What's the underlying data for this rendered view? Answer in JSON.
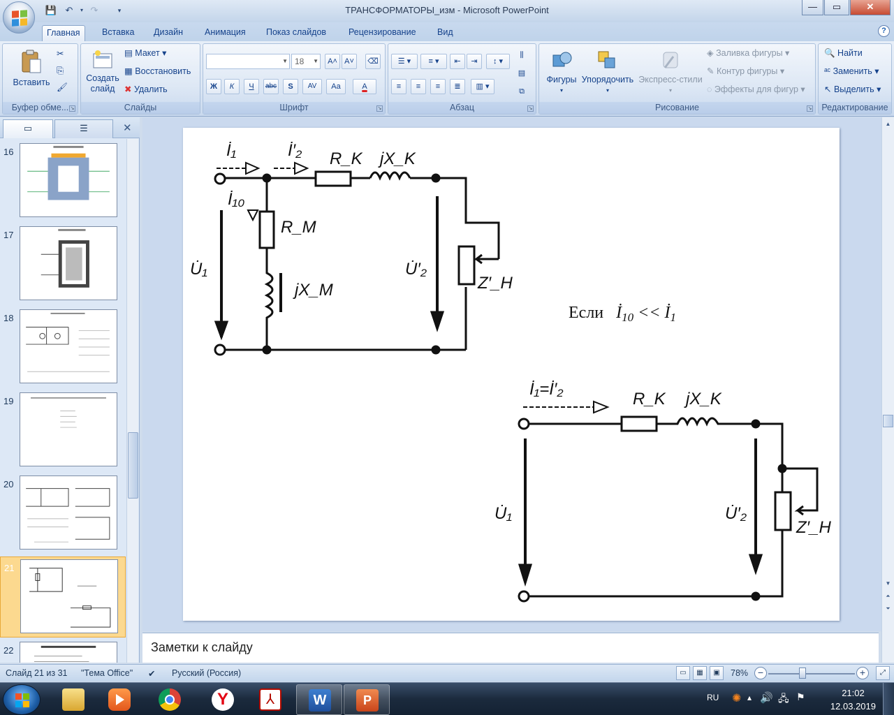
{
  "window": {
    "title": "ТРАНСФОРМАТОРЫ_изм - Microsoft PowerPoint",
    "minimize": "—",
    "restore": "▭",
    "close": "✕"
  },
  "tabs": [
    "Главная",
    "Вставка",
    "Дизайн",
    "Анимация",
    "Показ слайдов",
    "Рецензирование",
    "Вид"
  ],
  "help": "?",
  "ribbon": {
    "clipboard": {
      "group": "Буфер обме...",
      "paste": "Вставить"
    },
    "slides": {
      "group": "Слайды",
      "new_slide_1": "Создать",
      "new_slide_2": "слайд",
      "layout": "Макет",
      "reset": "Восстановить",
      "delete": "Удалить"
    },
    "font": {
      "group": "Шрифт",
      "font_name": "",
      "font_size": "18",
      "bold": "Ж",
      "italic": "К",
      "underline": "Ч",
      "strike": "abc",
      "shadow": "S",
      "spacing": "AV",
      "case": "Aa",
      "color": "A"
    },
    "paragraph": {
      "group": "Абзац"
    },
    "drawing": {
      "group": "Рисование",
      "shapes": "Фигуры",
      "arrange": "Упорядочить",
      "quick_styles": "Экспресс-стили",
      "fill": "Заливка фигуры",
      "outline": "Контур фигуры",
      "effects": "Эффекты для фигур"
    },
    "editing": {
      "group": "Редактирование",
      "find": "Найти",
      "replace": "Заменить",
      "select": "Выделить"
    }
  },
  "slides_panel": {
    "items": [
      {
        "num": "16"
      },
      {
        "num": "17"
      },
      {
        "num": "18"
      },
      {
        "num": "19"
      },
      {
        "num": "20"
      },
      {
        "num": "21",
        "selected": true
      },
      {
        "num": "22"
      }
    ]
  },
  "slide": {
    "circuit1": {
      "i1": "İ₁",
      "i2": "İ′₂",
      "rk": "R_K",
      "jxk": "jX_K",
      "i10": "İ₁₀",
      "rm": "R_M",
      "jxm": "jX_M",
      "u1": "U̇₁",
      "u2": "U̇′₂",
      "zh": "Z′_H"
    },
    "condition": {
      "text": "Если",
      "lhs": "İ",
      "lhs_sub": "10",
      "op": "<<",
      "rhs": "İ",
      "rhs_sub": "1"
    },
    "circuit2": {
      "i": "İ₁=İ′₂",
      "rk": "R_K",
      "jxk": "jX_K",
      "u1": "U̇₁",
      "u2": "U̇′₂",
      "zh": "Z′_H"
    }
  },
  "notes": "Заметки к слайду",
  "status": {
    "slide": "Слайд 21 из 31",
    "theme": "\"Тема Office\"",
    "language": "Русский (Россия)",
    "zoom": "78%",
    "zoom_level": 0.78
  },
  "taskbar": {
    "lang": "RU",
    "time": "21:02",
    "date": "12.03.2019"
  }
}
